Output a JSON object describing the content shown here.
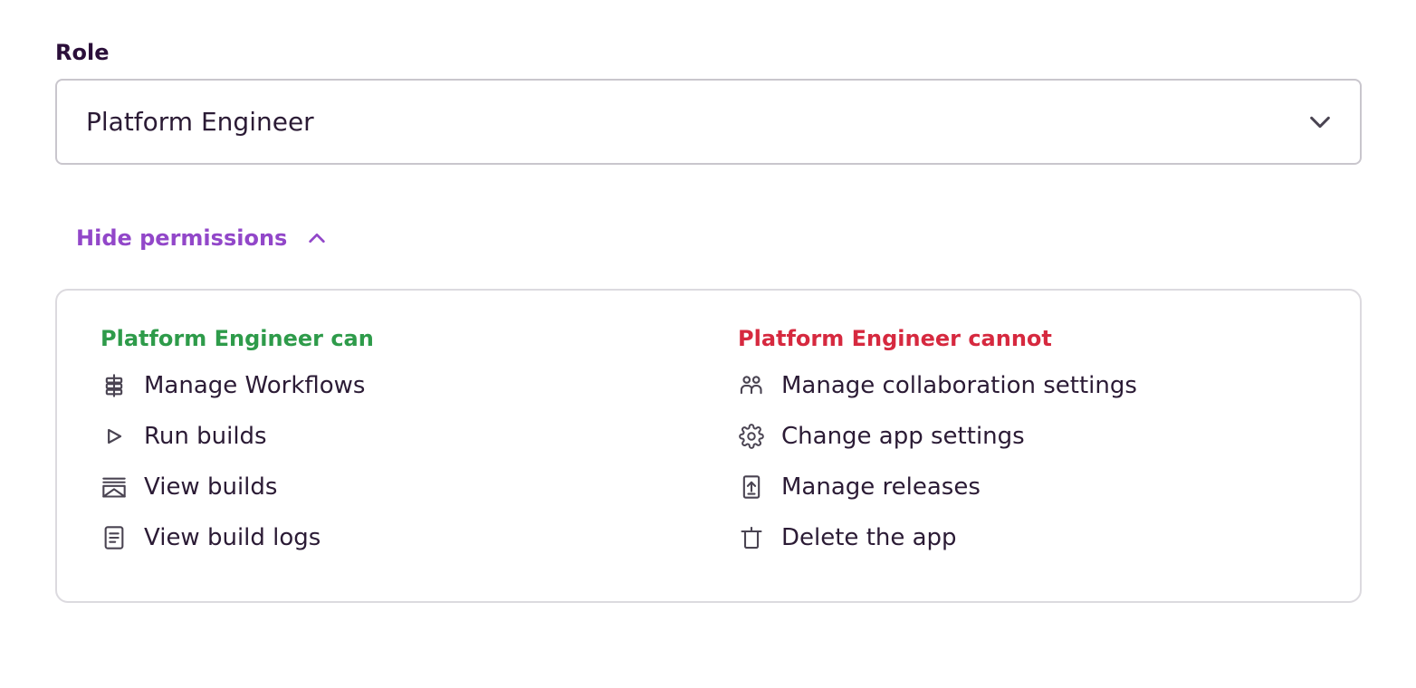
{
  "role_field": {
    "label": "Role",
    "selected": "Platform Engineer",
    "icon": "chevron-down-icon"
  },
  "permissions_toggle": {
    "label": "Hide permissions",
    "icon": "chevron-up-icon",
    "color": "#9247c9"
  },
  "permissions": {
    "can": {
      "heading": "Platform Engineer can",
      "color": "#2e9b4a",
      "items": [
        {
          "label": "Manage Workflows",
          "icon": "workflow-icon"
        },
        {
          "label": "Run builds",
          "icon": "play-icon"
        },
        {
          "label": "View builds",
          "icon": "builds-icon"
        },
        {
          "label": "View build logs",
          "icon": "log-document-icon"
        }
      ]
    },
    "cannot": {
      "heading": "Platform Engineer cannot",
      "color": "#d6293f",
      "items": [
        {
          "label": "Manage collaboration settings",
          "icon": "collaborators-icon"
        },
        {
          "label": "Change app settings",
          "icon": "gear-icon"
        },
        {
          "label": "Manage releases",
          "icon": "release-upload-icon"
        },
        {
          "label": "Delete the app",
          "icon": "trash-icon"
        }
      ]
    }
  }
}
